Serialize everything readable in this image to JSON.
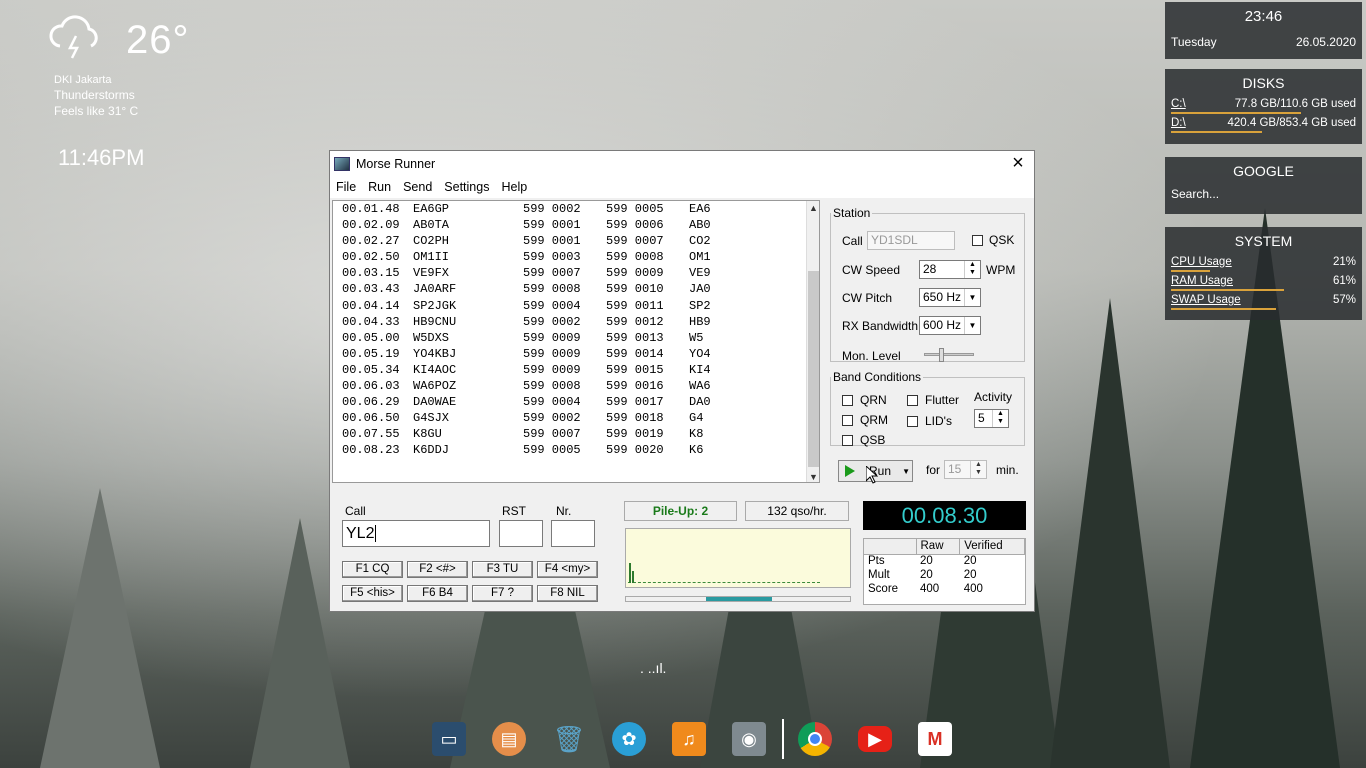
{
  "weather": {
    "temperature": "26°",
    "location": "DKI Jakarta",
    "condition": "Thunderstorms",
    "feels_like": "Feels like 31° C",
    "clock": "11:46PM"
  },
  "widgets": {
    "time": {
      "time": "23:46",
      "day": "Tuesday",
      "date": "26.05.2020"
    },
    "disks": {
      "title": "DISKS",
      "items": [
        {
          "label": "C:\\",
          "value": "77.8 GB/110.6 GB used",
          "usage": 0.7
        },
        {
          "label": "D:\\",
          "value": "420.4 GB/853.4 GB used",
          "usage": 0.49
        }
      ]
    },
    "google": {
      "title": "GOOGLE",
      "search_placeholder": "Search..."
    },
    "system": {
      "title": "SYSTEM",
      "items": [
        {
          "label": "CPU Usage",
          "value": "21%",
          "usage": 0.21
        },
        {
          "label": "RAM Usage",
          "value": "61%",
          "usage": 0.61
        },
        {
          "label": "SWAP Usage",
          "value": "57%",
          "usage": 0.57
        }
      ]
    }
  },
  "window": {
    "title": "Morse Runner",
    "menu": [
      "File",
      "Run",
      "Send",
      "Settings",
      "Help"
    ]
  },
  "log": [
    [
      "00.01.48",
      "EA6GP",
      "599 0002",
      "599 0005",
      "EA6"
    ],
    [
      "00.02.09",
      "AB0TA",
      "599 0001",
      "599 0006",
      "AB0"
    ],
    [
      "00.02.27",
      "CO2PH",
      "599 0001",
      "599 0007",
      "CO2"
    ],
    [
      "00.02.50",
      "OM1II",
      "599 0003",
      "599 0008",
      "OM1"
    ],
    [
      "00.03.15",
      "VE9FX",
      "599 0007",
      "599 0009",
      "VE9"
    ],
    [
      "00.03.43",
      "JA0ARF",
      "599 0008",
      "599 0010",
      "JA0"
    ],
    [
      "00.04.14",
      "SP2JGK",
      "599 0004",
      "599 0011",
      "SP2"
    ],
    [
      "00.04.33",
      "HB9CNU",
      "599 0002",
      "599 0012",
      "HB9"
    ],
    [
      "00.05.00",
      "W5DXS",
      "599 0009",
      "599 0013",
      "W5"
    ],
    [
      "00.05.19",
      "YO4KBJ",
      "599 0009",
      "599 0014",
      "YO4"
    ],
    [
      "00.05.34",
      "KI4AOC",
      "599 0009",
      "599 0015",
      "KI4"
    ],
    [
      "00.06.03",
      "WA6POZ",
      "599 0008",
      "599 0016",
      "WA6"
    ],
    [
      "00.06.29",
      "DA0WAE",
      "599 0004",
      "599 0017",
      "DA0"
    ],
    [
      "00.06.50",
      "G4SJX",
      "599 0002",
      "599 0018",
      "G4"
    ],
    [
      "00.07.55",
      "K8GU",
      "599 0007",
      "599 0019",
      "K8"
    ],
    [
      "00.08.23",
      "K6DDJ",
      "599 0005",
      "599 0020",
      "K6"
    ]
  ],
  "station": {
    "legend": "Station",
    "call_label": "Call",
    "call_value": "YD1SDL",
    "qsk_label": "QSK",
    "cw_speed_label": "CW Speed",
    "cw_speed_value": "28",
    "wpm_label": "WPM",
    "cw_pitch_label": "CW Pitch",
    "cw_pitch_value": "650 Hz",
    "rx_bw_label": "RX Bandwidth",
    "rx_bw_value": "600 Hz",
    "mon_level_label": "Mon. Level"
  },
  "band": {
    "legend": "Band Conditions",
    "qrn": "QRN",
    "qrm": "QRM",
    "qsb": "QSB",
    "flutter": "Flutter",
    "lids": "LID's",
    "activity_label": "Activity",
    "activity_value": "5"
  },
  "run": {
    "button": "Run",
    "for_label": "for",
    "minutes": "15",
    "min_label": "min."
  },
  "entry": {
    "call_label": "Call",
    "call_value": "YL2",
    "rst_label": "RST",
    "nr_label": "Nr."
  },
  "fkeys": [
    "F1 CQ",
    "F2 <#>",
    "F3 TU",
    "F4 <my>",
    "F5 <his>",
    "F6 B4",
    "F7 ?",
    "F8 NIL"
  ],
  "status": {
    "pileup": "Pile-Up:  2",
    "rate": "132  qso/hr.",
    "timer": "00.08.30"
  },
  "score": {
    "headers": [
      "",
      "Raw",
      "Verified"
    ],
    "rows": [
      [
        "Pts",
        "20",
        "20"
      ],
      [
        "Mult",
        "20",
        "20"
      ],
      [
        "Score",
        "400",
        "400"
      ]
    ]
  },
  "sound_indicator": ". ..ıl.",
  "taskbar": [
    "desktop-icon",
    "notes-icon",
    "trash-icon",
    "settings-icon",
    "music-icon",
    "camera-icon",
    "chrome-icon",
    "youtube-icon",
    "gmail-icon"
  ]
}
